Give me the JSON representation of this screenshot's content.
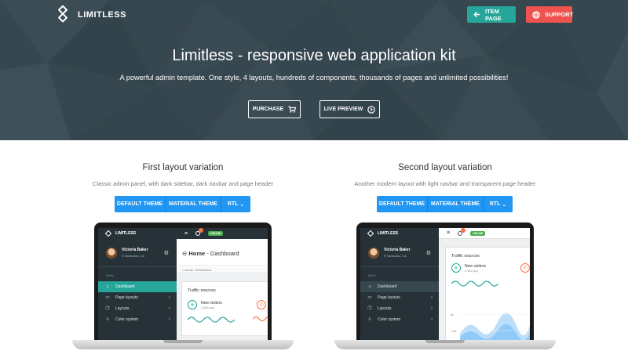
{
  "header": {
    "brand": "LIMITLESS",
    "item_page_label": "ITEM PAGE",
    "support_label": "SUPPORT"
  },
  "hero": {
    "title_brand": "Limitless",
    "title_rest": " - responsive web application kit",
    "subtitle": "A powerful admin template. One style, 4 layouts, hundreds of components, thousands of pages and unlimited possibilities!",
    "purchase_label": "PURCHASE",
    "live_preview_label": "LIVE PREVIEW"
  },
  "layouts": [
    {
      "title": "First layout variation",
      "description": "Classic admin panel, with dark sidebar, dark navbar and page header",
      "buttons": [
        "DEFAULT THEME",
        "MATERIAL THEME",
        "RTL"
      ]
    },
    {
      "title": "Second layout variation",
      "description": "Another modern layout with light navbar and transparent page header",
      "buttons": [
        "DEFAULT THEME",
        "MATERIAL THEME",
        "RTL"
      ]
    }
  ],
  "preview": {
    "brand": "LIMITLESS",
    "online_badge": "ONLINE",
    "user_name": "Victoria Baker",
    "user_location": "Santa Ana, CA",
    "main_label": "MAIN",
    "nav_items": [
      "Dashboard",
      "Page layouts",
      "Layouts",
      "Color system"
    ],
    "page_title_strong": "Home",
    "page_title_rest": " - Dashboard",
    "breadcrumb": "Home  /  Dashboard",
    "panel_title": "Traffic sources",
    "metric_label": "New visitors",
    "metric_value": "2,349 avg",
    "axis_labels": [
      "5k",
      "1.5k"
    ]
  },
  "colors": {
    "hero_bg": "#37474f",
    "teal": "#26a69a",
    "red": "#ef5350",
    "blue": "#2196f3",
    "dark": "#263238"
  }
}
